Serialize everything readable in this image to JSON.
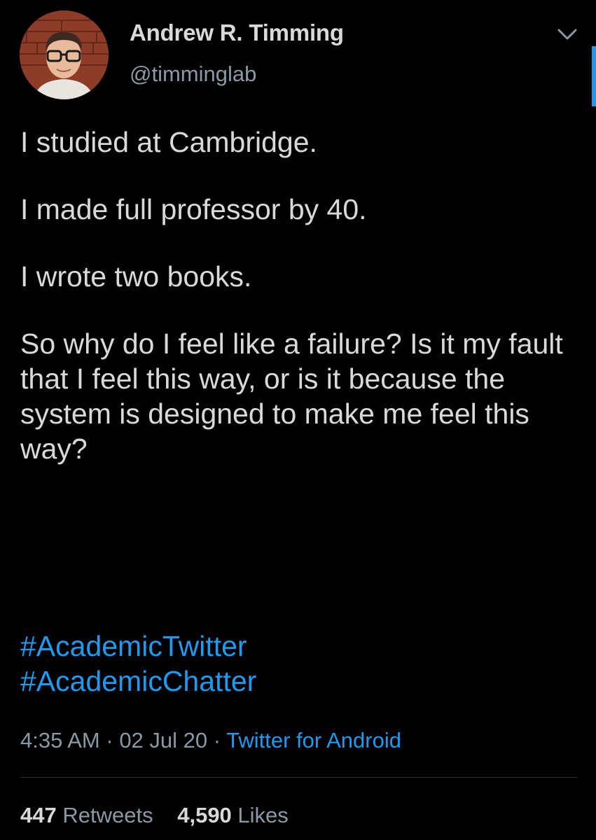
{
  "author": {
    "name": "Andrew R. Timming",
    "handle": "@timminglab",
    "avatar_icon": "profile-photo"
  },
  "tweet": {
    "paragraphs": [
      "I studied at Cambridge.",
      "I made full professor by 40.",
      "I wrote two books.",
      "So why do I feel like a failure? Is it my fault that I feel this way, or is it because the system is designed to make me feel this way?"
    ],
    "hashtags": [
      "#AcademicTwitter",
      "#AcademicChatter"
    ]
  },
  "meta": {
    "time": "4:35 AM",
    "separator": " · ",
    "date": "02 Jul 20",
    "source": "Twitter for Android"
  },
  "stats": {
    "retweets_count": "447",
    "retweets_label": "Retweets",
    "likes_count": "4,590",
    "likes_label": "Likes"
  },
  "colors": {
    "background": "#000000",
    "text": "#d9d9d9",
    "secondary": "#8b98a5",
    "accent": "#1d9bf0"
  }
}
